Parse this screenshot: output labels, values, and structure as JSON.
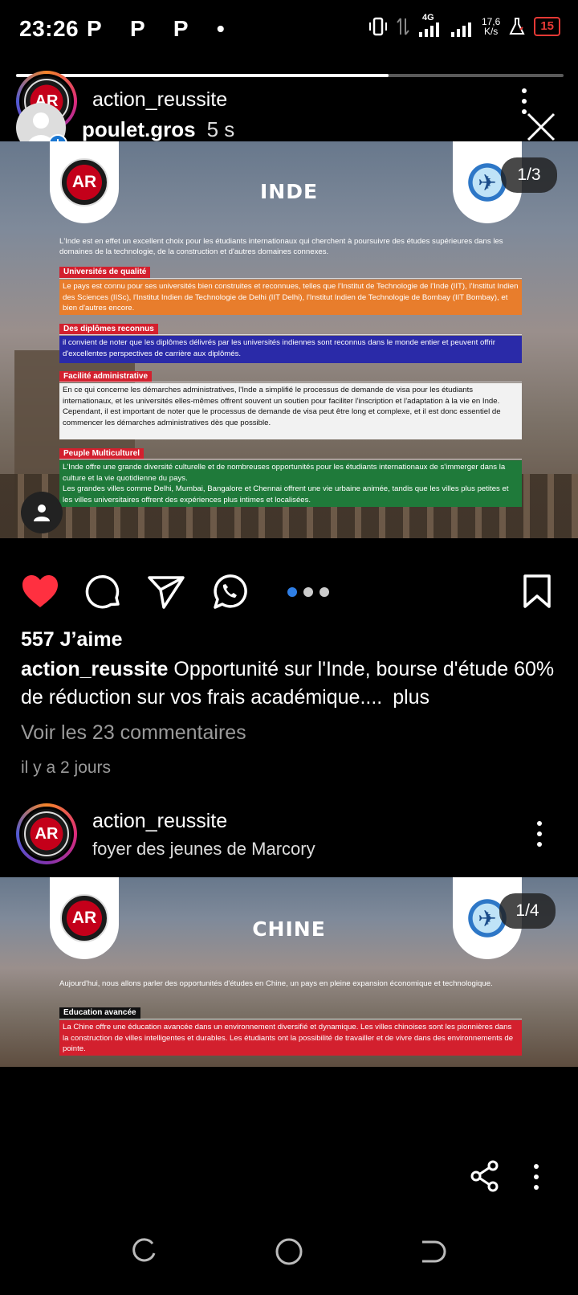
{
  "status_bar": {
    "time": "23:26",
    "app_icons": "P P P •",
    "network": "4G",
    "speed_value": "17,6",
    "speed_unit": "K/s",
    "battery": "15"
  },
  "story_progress_fraction": 0.68,
  "post1": {
    "username": "action_reussite",
    "counter": "1/3",
    "slide": {
      "title": "INDE",
      "intro": "L'Inde est en effet un excellent choix pour les étudiants internationaux qui cherchent à poursuivre des études supérieures dans les domaines de la technologie, de la construction et d'autres domaines connexes.",
      "sections": [
        {
          "label": "Universités de qualité",
          "text": "Le pays est connu pour ses universités bien construites et reconnues, telles que l'Institut de Technologie de l'Inde (IIT), l'Institut Indien des Sciences (IISc), l'Institut Indien de Technologie de Delhi (IIT Delhi), l'Institut Indien de Technologie de Bombay (IIT Bombay), et bien d'autres encore."
        },
        {
          "label": "Des diplômes reconnus",
          "text": "il convient de noter que les diplômes délivrés par les universités indiennes sont reconnus dans le monde entier et peuvent offrir d'excellentes perspectives de carrière aux diplômés."
        },
        {
          "label": "Facilité administrative",
          "text": "En ce qui concerne les démarches administratives, l'Inde a simplifié le processus de demande de visa pour les étudiants internationaux, et les universités elles-mêmes offrent souvent un soutien pour faciliter l'inscription et l'adaptation à la vie en Inde. Cependant, il est important de noter que le processus de demande de visa peut être long et complexe, et il est donc essentiel de commencer les démarches administratives dès que possible."
        },
        {
          "label": "Peuple Multiculturel",
          "text": "L'Inde offre une grande diversité culturelle et de nombreuses opportunités pour les étudiants internationaux de s'immerger dans la culture et la vie quotidienne du pays.\nLes grandes villes comme Delhi, Mumbai, Bangalore et Chennai offrent une vie urbaine animée, tandis que les villes plus petites et les villes universitaires offrent des expériences plus intimes et localisées."
        }
      ]
    },
    "likes": "557 J’aime",
    "caption_user": "action_reussite",
    "caption_text": "Opportunité sur l'Inde, bourse d'étude 60% de réduction sur vos frais académique....",
    "more": "plus",
    "comments_link": "Voir les 23 commentaires",
    "date": "il y a 2 jours"
  },
  "story_overlay": {
    "username": "poulet.gros",
    "time": "5 s"
  },
  "post2": {
    "username": "action_reussite",
    "location": "foyer des jeunes de Marcory",
    "counter": "1/4",
    "slide": {
      "title": "CHINE",
      "intro": "Aujourd'hui, nous allons parler des opportunités d'études en Chine, un pays en pleine expansion économique et technologique.",
      "section_label": "Education avancée",
      "section_text": "La Chine offre une éducation avancée dans un environnement diversifié et dynamique. Les villes chinoises sont les pionnières dans la construction de villes intelligentes et durables. Les étudiants ont la possibilité de travailler et de vivre dans des environnements de pointe."
    }
  },
  "colors": {
    "section_orange": "#e87d2c",
    "section_blue": "#2a2aa8",
    "section_white": "#f2f2f2",
    "section_green": "#1f7a3a",
    "label_red": "#d3202e",
    "like_red": "#ff3040",
    "dot_active": "#2f7fe6"
  },
  "icons": [
    "heart-icon",
    "comment-icon",
    "send-icon",
    "whatsapp-icon",
    "bookmark-icon",
    "share-icon",
    "more-icon",
    "close-icon",
    "person-icon",
    "plus-icon"
  ]
}
